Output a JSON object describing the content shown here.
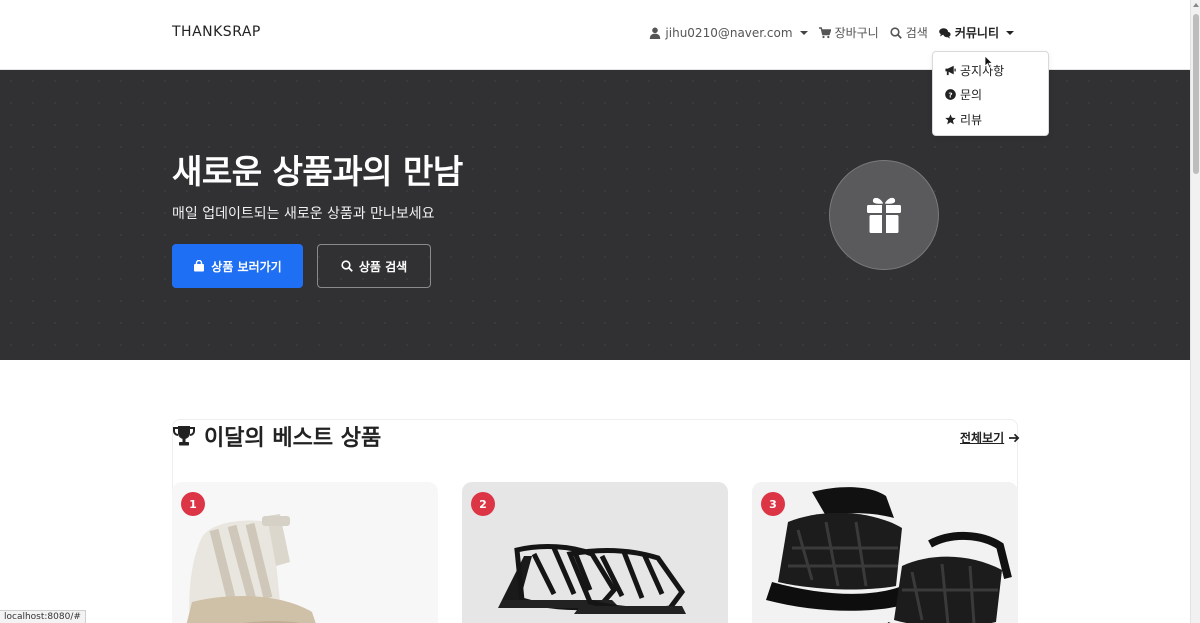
{
  "navbar": {
    "brand": "THANKSRAP",
    "user_email": "jihu0210@naver.com",
    "cart_label": "장바구니",
    "search_label": "검색",
    "community_label": "커뮤니티"
  },
  "community_menu": {
    "items": [
      {
        "label": "공지사항",
        "icon": "megaphone-icon"
      },
      {
        "label": "문의",
        "icon": "question-circle-icon"
      },
      {
        "label": "리뷰",
        "icon": "star-icon"
      }
    ]
  },
  "hero": {
    "title": "새로운 상품과의 만남",
    "subtitle": "매일 업데이트되는 새로운 상품과 만나보세요",
    "primary_button": "상품 보러가기",
    "secondary_button": "상품 검색",
    "icon": "gift-icon"
  },
  "best": {
    "title": "이달의 베스트 상품",
    "see_all": "전체보기",
    "products": [
      {
        "rank": "1",
        "image": "beige-sandal"
      },
      {
        "rank": "2",
        "image": "black-strappy-sandal"
      },
      {
        "rank": "3",
        "image": "black-fisherman-sandal"
      }
    ]
  },
  "statusbar": {
    "url": "localhost:8080/#"
  },
  "colors": {
    "hero_bg": "#313033",
    "primary": "#1f6ff5",
    "rank_badge": "#dc3545"
  }
}
